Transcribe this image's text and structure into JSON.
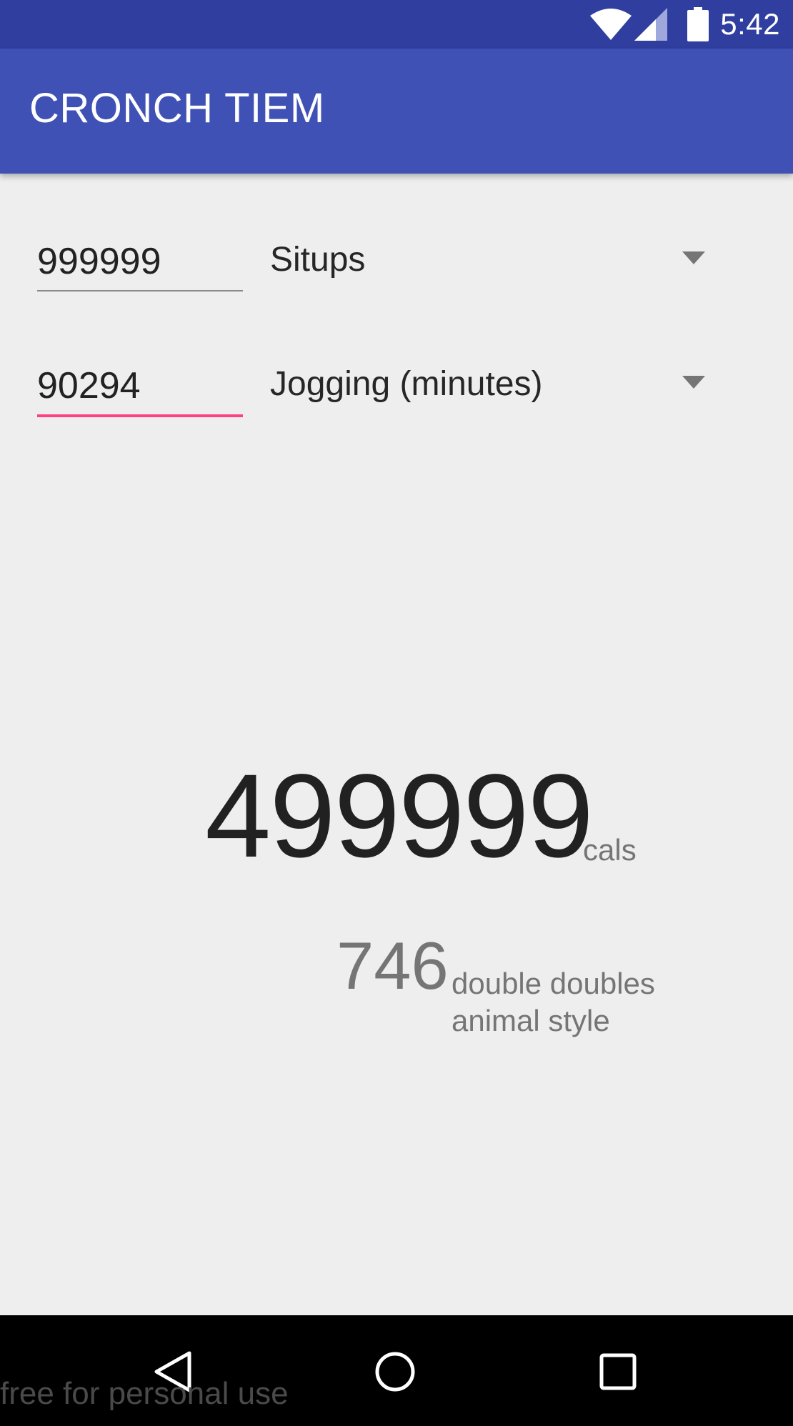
{
  "status_bar": {
    "time": "5:42",
    "icons": [
      "wifi-icon",
      "cellular-signal-icon",
      "battery-icon"
    ],
    "background_color": "#303f9f"
  },
  "app_bar": {
    "title": "CRONCH TIEM",
    "background_color": "#3f51b5"
  },
  "rows": [
    {
      "amount_value": "999999",
      "activity_selected": "Situps",
      "focused": false
    },
    {
      "amount_value": "90294",
      "activity_selected": "Jogging (minutes)",
      "focused": true
    }
  ],
  "result": {
    "calories_value": "499999",
    "calories_unit": "cals",
    "equivalent_value": "746",
    "equivalent_unit_line1": "double doubles",
    "equivalent_unit_line2": "animal style"
  },
  "nav_bar": {
    "buttons": [
      "back-icon",
      "home-icon",
      "recents-icon"
    ]
  },
  "watermark": {
    "text": "free for personal use"
  },
  "colors": {
    "accent": "#ff4081",
    "background": "#eeeeee"
  }
}
